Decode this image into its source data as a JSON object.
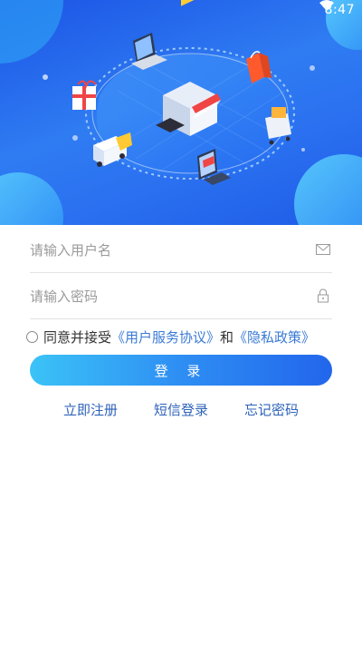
{
  "status_bar": {
    "time": "8:47",
    "wifi_icon": "wifi-icon"
  },
  "hero": {
    "illustration": "online-store-illustration",
    "gradient_start": "#1c54e6",
    "gradient_end": "#2f7cf2"
  },
  "form": {
    "username_placeholder": "请输入用户名",
    "username_icon": "envelope-icon",
    "password_placeholder": "请输入密码",
    "password_icon": "lock-icon"
  },
  "agreement": {
    "prefix": "同意并接受",
    "user_agreement": "《用户服务协议》",
    "conjunction": "和",
    "privacy_policy": "《隐私政策》"
  },
  "login_button": {
    "label": "登 录",
    "color_start": "#3bc3f7",
    "color_end": "#2266ec"
  },
  "links": {
    "register": "立即注册",
    "sms_login": "短信登录",
    "forgot_password": "忘记密码"
  }
}
